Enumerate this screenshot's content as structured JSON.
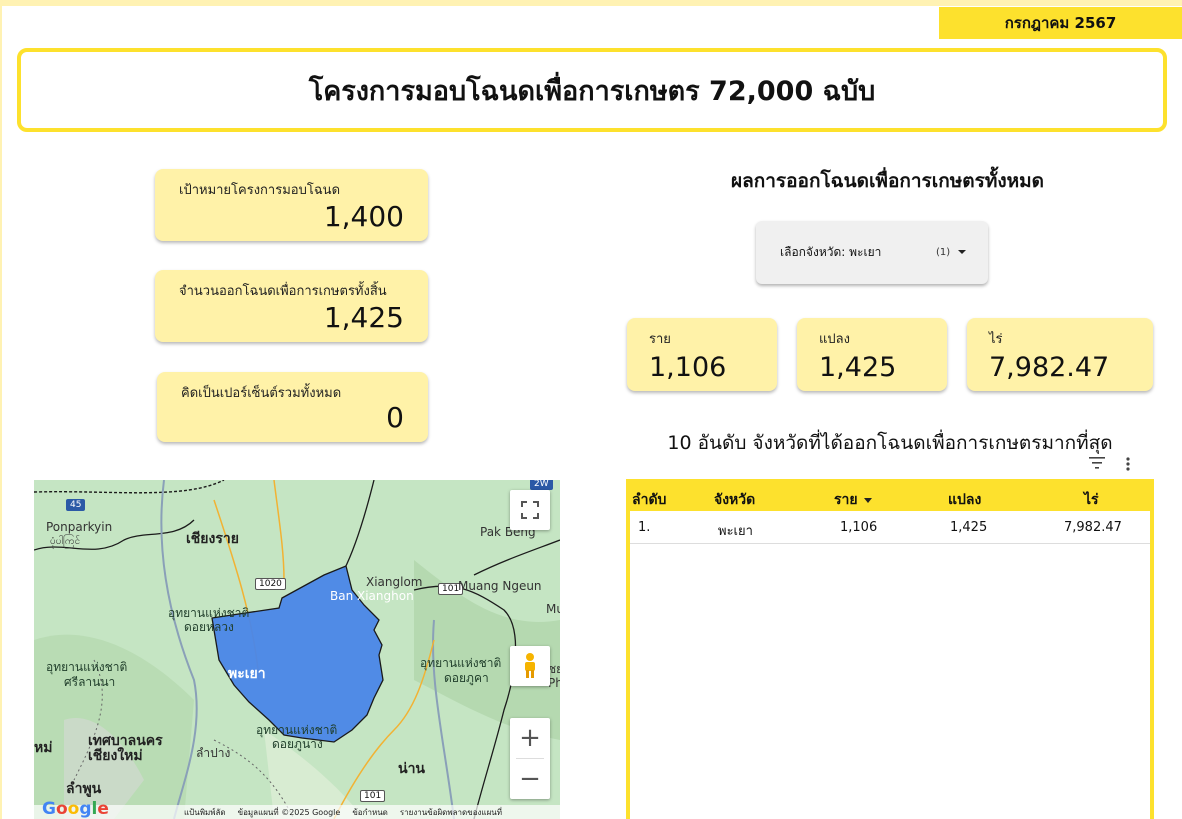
{
  "header": {
    "date": "กรกฎาคม 2567",
    "title": "โครงการมอบโฉนดเพื่อการเกษตร 72,000 ฉบับ"
  },
  "kpis": [
    {
      "label": "เป้าหมายโครงการมอบโฉนด",
      "value": "1,400"
    },
    {
      "label": "จำนวนออกโฉนดเพื่อการเกษตรทั้งสิ้น",
      "value": "1,425"
    },
    {
      "label": "คิดเป็นเปอร์เซ็นต์รวมทั้งหมด",
      "value": "0"
    }
  ],
  "results": {
    "title": "ผลการออกโฉนดเพื่อการเกษตรทั้งหมด",
    "filter": {
      "label": "เลือกจังหวัด: พะเยา",
      "count": "(1)"
    },
    "cards": [
      {
        "label": "ราย",
        "value": "1,106"
      },
      {
        "label": "แปลง",
        "value": "1,425"
      },
      {
        "label": "ไร่",
        "value": "7,982.47"
      }
    ]
  },
  "ranking": {
    "title": "10 อันดับ จังหวัดที่ได้ออกโฉนดเพื่อการเกษตรมากที่สุด",
    "columns": [
      "ลำดับ",
      "จังหวัด",
      "ราย",
      "แปลง",
      "ไร่"
    ],
    "rows": [
      {
        "rank": "1.",
        "province": "พะเยา",
        "people": "1,106",
        "plots": "1,425",
        "rai": "7,982.47"
      }
    ]
  },
  "map": {
    "labels": {
      "ponparkyin": "Ponparkyin",
      "ponparkyin_mm": "ပုံပါကြင်",
      "chiangrai": "เชียงราย",
      "pakbeng": "Pak Beng",
      "xianglom": "Xianglom",
      "muangngeun": "Muang Ngeun",
      "banxianghon": "Ban Xianghon",
      "np_doiluang_1": "อุทยานแห่งชาติ",
      "np_doiluang_2": "ดอยหลวง",
      "np_srilanna_1": "อุทยานแห่งชาติ",
      "np_srilanna_2": "ศรีลานนา",
      "phayao": "พะเยา",
      "np_doiphukha_1": "อุทยานแห่งชาติ",
      "np_doiphukha_2": "ดอยภูคา",
      "np_doiphunang_1": "อุทยานแห่งชาติ",
      "np_doiphunang_2": "ดอยภูนาง",
      "chiangmai_city_1": "เทศบาลนคร",
      "chiangmai_city_2": "เชียงใหม่",
      "hmai": "หม่",
      "lampang": "ลำปาง",
      "nan": "น่าน",
      "lamphun": "ลำพูน",
      "mu": "Mu",
      "ph": "Ph",
      "chai": "ชย",
      "road_45": "45",
      "road_1020": "1020",
      "road_101a": "101",
      "road_101b": "101",
      "road_2w": "2W",
      "google": "Google",
      "attr_shortcuts": "แป้นพิมพ์ลัด",
      "attr_data": "ข้อมูลแผนที่ ©2025 Google",
      "attr_terms": "ข้อกำหนด",
      "attr_report": "รายงานข้อผิดพลาดของแผนที่"
    },
    "colors": {
      "land": "#c8e6c9",
      "highlight": "#4a86e8",
      "water": "#9fbcd8"
    }
  }
}
